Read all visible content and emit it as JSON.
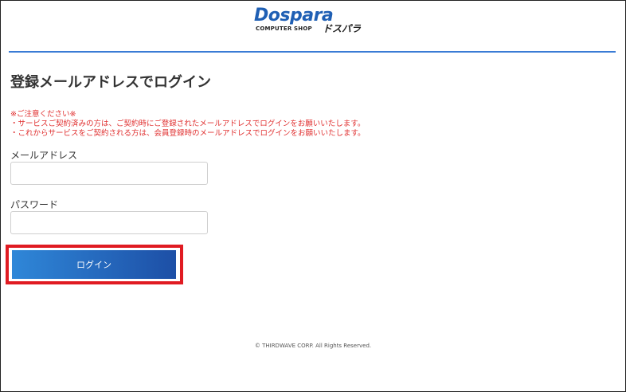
{
  "header": {
    "logo_main": "Dospara",
    "logo_sub": "COMPUTER SHOP",
    "logo_kana": "ドスパラ"
  },
  "colors": {
    "accent_blue": "#3a7bd5",
    "notice_red": "#e03030",
    "highlight_red": "#e01b22",
    "button_gradient_start": "#2f87d8",
    "button_gradient_end": "#1d4fa6"
  },
  "main": {
    "title": "登録メールアドレスでログイン",
    "notice": {
      "heading": "※ご注意ください※",
      "lines": [
        "・サービスご契約済みの方は、ご契約時にご登録されたメールアドレスでログインをお願いいたします。",
        "・これからサービスをご契約される方は、会員登録時のメールアドレスでログインをお願いいたします。"
      ]
    },
    "email": {
      "label": "メールアドレス",
      "value": "",
      "placeholder": ""
    },
    "password": {
      "label": "パスワード",
      "value": "",
      "placeholder": ""
    },
    "login_button": "ログイン"
  },
  "footer": {
    "copyright": "© THIRDWAVE CORP. All Rights Reserved."
  }
}
